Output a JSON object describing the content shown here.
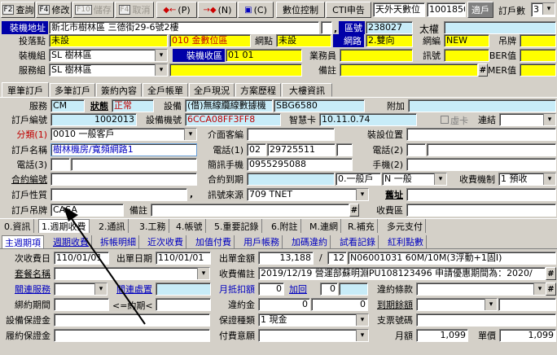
{
  "toolbar": {
    "query": "查詢",
    "edit": "修改",
    "save": "儲存",
    "cancel": "取消",
    "prev": "(P)",
    "next": "(N)",
    "lock": "(C)",
    "digital": "數位控制",
    "cti": "CTI申告",
    "tvlabel": "天外天數位",
    "code": "1001850",
    "suitelabel": "適戶",
    "countlabel": "訂戶數",
    "count": "3",
    "k_query": "F2",
    "k_edit": "F4",
    "k_save": "F10",
    "k_cancel": "F4"
  },
  "header": {
    "addr_label": "裝機地址",
    "addr": "新北市樹林區 三德街29-6號2樓",
    "zone_label": "區號",
    "zone": "238027",
    "tai_label": "太權",
    "drop_label": "投落點",
    "drop": "未設",
    "drop_code": "010 金數位區",
    "netpt_label": "網點",
    "netpt": "未設",
    "netrd_label": "網路",
    "netrd": "2.雙向",
    "netgroup_label": "網編",
    "netgroup": "NEW",
    "tower_label": "吊牌",
    "install_zone_label": "裝機組",
    "install_zone": "SL 樹林區",
    "install_area_label": "裝機收區",
    "install_area": "01 01",
    "sales_label": "業務員",
    "signal_label": "訊號",
    "ber_label": "BER值",
    "service_label": "服務組",
    "service": "SL 樹林區",
    "memo_label": "備註",
    "mer_label": "MER值"
  },
  "tabs": [
    "單筆訂戶",
    "多筆訂戶",
    "簽約內容",
    "全戶帳單",
    "全戶現況",
    "方案歷程",
    "大樓資訊"
  ],
  "form": {
    "svc_label": "服務",
    "svc": "CM",
    "status_label": "狀態",
    "status": "正常",
    "device_label": "設備",
    "device": "(借)無線纜線數據機",
    "device_model": "SBG6580",
    "attach_label": "附加",
    "sub_no_label": "訂戶編號",
    "sub_no": "1002013",
    "mac_label": "設備機號",
    "mac": "6CCA08FF3FF8",
    "card_label": "智慧卡",
    "card": "10.11.0.74",
    "vcard_label": "虛卡",
    "link_label": "連結",
    "class_label": "分類(1)",
    "class": "0010 一般客戶",
    "intro_label": "介面客編",
    "loc_label": "裝設位置",
    "name_label": "訂戶名稱",
    "name": "樹林機房/寬頻網路1",
    "tel1_label": "電話(1)",
    "tel1_a": "02",
    "tel1_b": "29725511",
    "tel2_label": "電話(2)",
    "tel3_label": "電話(3)",
    "sms_label": "簡訊手機",
    "sms": "0955295088",
    "mobile_label": "手機(2)",
    "contract_label": "合約編號",
    "contract_end_label": "合約到期",
    "contract_type": "0.一般戶",
    "gen": "N 一般",
    "fee_label": "收費機制",
    "fee": "1 預收",
    "nature_label": "訂戶性質",
    "source_label": "訊號來源",
    "source": "709 TNET",
    "old_addr_label": "舊址",
    "tower2_label": "訂戶吊牌",
    "tower2": "CASA",
    "memo2_label": "備註",
    "collect_label": "收費區"
  },
  "bottom_tabs": [
    "0.資訊",
    "1.週期收費",
    "2.通訊",
    "3.工務",
    "4.帳號",
    "5.重要記錄",
    "6.附註",
    "M.連網",
    "R.補充",
    "多元支付"
  ],
  "sub_tabs": [
    "主週期項",
    "週期收費",
    "拆帳明細",
    "近次收費",
    "加值付費",
    "用戶帳務",
    "加碼違約",
    "試看記錄",
    "紅利點數"
  ],
  "billing": {
    "next_label": "次收費日",
    "next": "110/01/01",
    "out_label": "出單日期",
    "out": "110/01/01",
    "amt_label": "出單金額",
    "amt": "13,188",
    "slash": "/",
    "period": "12",
    "plan": "N06001031 60M/10M(3浮動+1固I)",
    "plan_name_label": "套餐名稱",
    "remark_label": "收費備註",
    "remark": "2019/12/19 營運部蘇明淵PU108123496 申請優惠期間為：2020/",
    "rel_svc_label": "關連服務",
    "rel_pos_label": "關連處置",
    "deduct_label": "月抵扣額",
    "deduct": "0",
    "add_label": "加回",
    "add_val": "0",
    "breach_label": "違約條款",
    "term_label": "綁約期間",
    "term_sep": "<=約期<",
    "penalty_label": "違約金",
    "penalty1": "0",
    "penalty2": "0",
    "due_label": "到期餘額",
    "deposit_label": "設備保證金",
    "guarantee_label": "保證種類",
    "guarantee": "1 現金",
    "check_label": "支票號碼",
    "perf_label": "履約保證金",
    "paid_label": "付費意願",
    "monthly_label": "月額",
    "monthly": "1,099",
    "unit_label": "單價",
    "unit": "1,099"
  }
}
